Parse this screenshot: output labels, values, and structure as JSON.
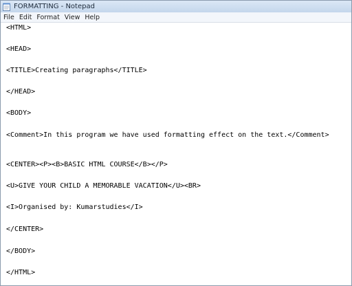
{
  "window": {
    "title": "FORMATTING - Notepad"
  },
  "menu": {
    "items": [
      "File",
      "Edit",
      "Format",
      "View",
      "Help"
    ]
  },
  "editor": {
    "lines": [
      "<HTML>",
      "<HEAD>",
      "<TITLE>Creating paragraphs</TITLE>",
      "</HEAD>",
      "<BODY>",
      "<Comment>In this program we have used formatting effect on the text.</Comment>",
      "<CENTER><P><B>BASIC HTML COURSE</B></P>",
      "<U>GIVE YOUR CHILD A MEMORABLE VACATION</U><BR>",
      "<I>Organised by: Kumarstudies</I>",
      "</CENTER>",
      "</BODY>",
      "</HTML>"
    ]
  },
  "icons": {
    "app": "notepad-icon"
  }
}
